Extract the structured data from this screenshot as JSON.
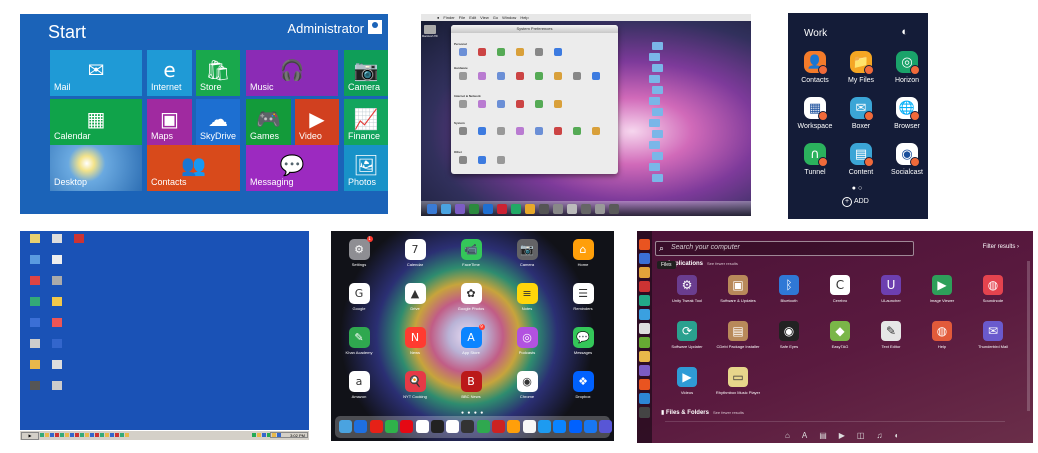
{
  "win8": {
    "title": "Start",
    "user": "Administrator",
    "tiles": [
      {
        "label": "Mail",
        "icon": "envelope-icon",
        "glyph": "✉",
        "color": "#1f9ad6"
      },
      {
        "label": "Internet",
        "icon": "ie-icon",
        "glyph": "e",
        "color": "#1f9ad6"
      },
      {
        "label": "Store",
        "icon": "store-icon",
        "glyph": "🛍",
        "color": "#19a84c"
      },
      {
        "label": "Music",
        "icon": "headphones-icon",
        "glyph": "🎧",
        "color": "#8b2bb5"
      },
      {
        "label": "Camera",
        "icon": "camera-icon",
        "glyph": "📷",
        "color": "#0f9e58"
      },
      {
        "label": "Calendar",
        "icon": "calendar-icon",
        "glyph": "▦",
        "color": "#10a34a"
      },
      {
        "label": "Maps",
        "icon": "maps-icon",
        "glyph": "▣",
        "color": "#a02aa0"
      },
      {
        "label": "SkyDrive",
        "icon": "cloud-icon",
        "glyph": "☁",
        "color": "#1d6fd1"
      },
      {
        "label": "Games",
        "icon": "controller-icon",
        "glyph": "🎮",
        "color": "#139b3a"
      },
      {
        "label": "Video",
        "icon": "video-icon",
        "glyph": "▶",
        "color": "#d1401f"
      },
      {
        "label": "Finance",
        "icon": "chart-icon",
        "glyph": "📈",
        "color": "#13a55e"
      },
      {
        "label": "Desktop",
        "icon": "desktop-icon",
        "glyph": "",
        "color": "#3e86c8"
      },
      {
        "label": "Contacts",
        "icon": "people-icon",
        "glyph": "👥",
        "color": "#d84a1b"
      },
      {
        "label": "Messaging",
        "icon": "message-icon",
        "glyph": "💬",
        "color": "#9c2ac0"
      },
      {
        "label": "Photos",
        "icon": "photo-icon",
        "glyph": "🖼",
        "color": "#1892c8"
      }
    ]
  },
  "mac": {
    "menu": [
      "Finder",
      "File",
      "Edit",
      "View",
      "Go",
      "Window",
      "Help"
    ],
    "window_title": "System Preferences",
    "sections": [
      "Personal",
      "Hardware",
      "Internet & Network",
      "System",
      "Other"
    ],
    "hd_label": "Macintosh HD"
  },
  "samsung": {
    "title": "Work",
    "palette_icon": "palette-icon",
    "apps": [
      {
        "label": "Contacts",
        "icon": "contacts-icon",
        "glyph": "👤",
        "color": "#f47b2a"
      },
      {
        "label": "My Files",
        "icon": "folder-icon",
        "glyph": "📁",
        "color": "#f5a623"
      },
      {
        "label": "Horizon",
        "icon": "horizon-icon",
        "glyph": "◎",
        "color": "#1aa36a"
      },
      {
        "label": "Workspace",
        "icon": "workspace-icon",
        "glyph": "▦",
        "color": "#ffffff"
      },
      {
        "label": "Boxer",
        "icon": "boxer-icon",
        "glyph": "✉",
        "color": "#3ba5d6"
      },
      {
        "label": "Browser",
        "icon": "browser-icon",
        "glyph": "🌐",
        "color": "#ffffff"
      },
      {
        "label": "Tunnel",
        "icon": "tunnel-icon",
        "glyph": "∩",
        "color": "#2bb25d"
      },
      {
        "label": "Content",
        "icon": "content-icon",
        "glyph": "▤",
        "color": "#3ba5d6"
      },
      {
        "label": "Socialcast",
        "icon": "socialcast-icon",
        "glyph": "◉",
        "color": "#ffffff"
      }
    ],
    "add_label": "ADD"
  },
  "xp": {
    "taskbar_clock": "3:02 PM"
  },
  "ipad": {
    "apps": [
      {
        "label": "Settings",
        "icon": "settings-icon",
        "glyph": "⚙",
        "color": "#8e8e93",
        "badge": "1"
      },
      {
        "label": "Calendar",
        "icon": "calendar-icon",
        "glyph": "7",
        "color": "#ffffff",
        "badge": ""
      },
      {
        "label": "FaceTime",
        "icon": "facetime-icon",
        "glyph": "📹",
        "color": "#34c759",
        "badge": ""
      },
      {
        "label": "Camera",
        "icon": "camera-icon",
        "glyph": "📷",
        "color": "#636366",
        "badge": ""
      },
      {
        "label": "Home",
        "icon": "home-icon",
        "glyph": "⌂",
        "color": "#ff9f0a",
        "badge": ""
      },
      {
        "label": "Google",
        "icon": "google-icon",
        "glyph": "G",
        "color": "#ffffff",
        "badge": ""
      },
      {
        "label": "Drive",
        "icon": "drive-icon",
        "glyph": "▲",
        "color": "#ffffff",
        "badge": ""
      },
      {
        "label": "Google Photos",
        "icon": "gphotos-icon",
        "glyph": "✿",
        "color": "#ffffff",
        "badge": ""
      },
      {
        "label": "Notes",
        "icon": "notes-icon",
        "glyph": "≡",
        "color": "#ffd60a",
        "badge": ""
      },
      {
        "label": "Reminders",
        "icon": "reminders-icon",
        "glyph": "☰",
        "color": "#ffffff",
        "badge": ""
      },
      {
        "label": "Khan Academy",
        "icon": "khan-icon",
        "glyph": "✎",
        "color": "#2fa84f",
        "badge": ""
      },
      {
        "label": "News",
        "icon": "news-icon",
        "glyph": "N",
        "color": "#ff3b30",
        "badge": ""
      },
      {
        "label": "App Store",
        "icon": "appstore-icon",
        "glyph": "A",
        "color": "#0a84ff",
        "badge": "9"
      },
      {
        "label": "Podcasts",
        "icon": "podcasts-icon",
        "glyph": "◎",
        "color": "#b252e0",
        "badge": ""
      },
      {
        "label": "Messages",
        "icon": "messages-icon",
        "glyph": "💬",
        "color": "#34c759",
        "badge": ""
      },
      {
        "label": "Amazon",
        "icon": "amazon-icon",
        "glyph": "a",
        "color": "#ffffff",
        "badge": ""
      },
      {
        "label": "NYT Cooking",
        "icon": "nyt-cooking-icon",
        "glyph": "🍳",
        "color": "#e63946",
        "badge": ""
      },
      {
        "label": "BBC News",
        "icon": "bbc-news-icon",
        "glyph": "B",
        "color": "#bb1919",
        "badge": ""
      },
      {
        "label": "Chrome",
        "icon": "chrome-icon",
        "glyph": "◉",
        "color": "#ffffff",
        "badge": ""
      },
      {
        "label": "Dropbox",
        "icon": "dropbox-icon",
        "glyph": "❖",
        "color": "#0061ff",
        "badge": ""
      }
    ]
  },
  "ubuntu": {
    "search_placeholder": "Search your computer",
    "filter_label": "Filter results",
    "apps_heading": "Applications",
    "see_more": "See fewer results",
    "tooltip": "Files",
    "files_heading": "Files & Folders",
    "files_see_more": "See fewer results",
    "apps": [
      {
        "label": "Unity Tweak Tool",
        "icon": "tweak-icon",
        "glyph": "⚙",
        "color": "#6a3d8f"
      },
      {
        "label": "Software & Updates",
        "icon": "software-updates-icon",
        "glyph": "▣",
        "color": "#b8895a"
      },
      {
        "label": "Bluetooth",
        "icon": "bluetooth-icon",
        "glyph": "ᛒ",
        "color": "#2f78d6"
      },
      {
        "label": "Cerebro",
        "icon": "cerebro-icon",
        "glyph": "C",
        "color": "#ffffff"
      },
      {
        "label": "ULauncher",
        "icon": "ulauncher-icon",
        "glyph": "U",
        "color": "#6d3fb0"
      },
      {
        "label": "Image Viewer",
        "icon": "image-viewer-icon",
        "glyph": "▶",
        "color": "#2e9f5a"
      },
      {
        "label": "Soundnode",
        "icon": "soundnode-icon",
        "glyph": "◍",
        "color": "#e4434e"
      },
      {
        "label": "Software Updater",
        "icon": "software-updater-icon",
        "glyph": "⟳",
        "color": "#2aa18f"
      },
      {
        "label": "CDebi Package Installer",
        "icon": "package-installer-icon",
        "glyph": "▤",
        "color": "#b8895a"
      },
      {
        "label": "Safe Eyes",
        "icon": "safe-eyes-icon",
        "glyph": "◉",
        "color": "#222222"
      },
      {
        "label": "EasyTAG",
        "icon": "easytag-icon",
        "glyph": "◆",
        "color": "#7ab648"
      },
      {
        "label": "Text Editor",
        "icon": "text-editor-icon",
        "glyph": "✎",
        "color": "#e6e6e6"
      },
      {
        "label": "Help",
        "icon": "help-icon",
        "glyph": "◍",
        "color": "#e25a3a"
      },
      {
        "label": "Thunderbird Mail",
        "icon": "thunderbird-icon",
        "glyph": "✉",
        "color": "#6a5acd"
      },
      {
        "label": "Videos",
        "icon": "videos-icon",
        "glyph": "▶",
        "color": "#2f9bd6"
      },
      {
        "label": "Rhythmbox Music Player",
        "icon": "rhythmbox-icon",
        "glyph": "▭",
        "color": "#e7d68b"
      }
    ],
    "lenses": [
      "⌂",
      "A",
      "▤",
      "▶",
      "◫",
      "♫",
      "◐"
    ]
  }
}
